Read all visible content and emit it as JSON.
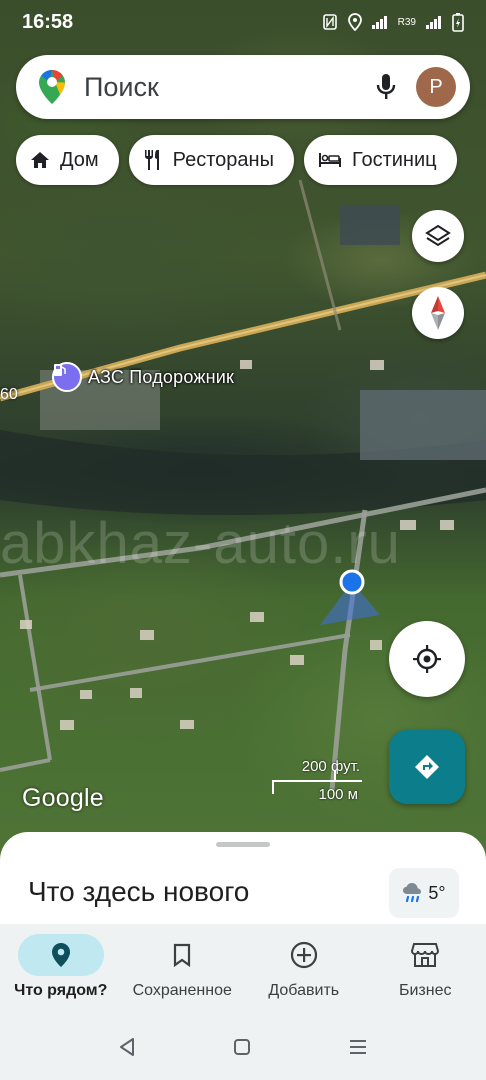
{
  "status_bar": {
    "time": "16:58",
    "network_label": "R39"
  },
  "search": {
    "placeholder": "Поиск",
    "avatar_letter": "P"
  },
  "chips": [
    {
      "label": "Дом",
      "icon": "home-icon"
    },
    {
      "label": "Рестораны",
      "icon": "restaurant-icon"
    },
    {
      "label": "Гостиниц",
      "icon": "hotel-icon"
    }
  ],
  "map": {
    "poi_label": "АЗС Подорожник",
    "road_number": "60",
    "watermark": "abkhaz-auto.ru",
    "google_logo": "Google",
    "scale_imperial": "200 фут.",
    "scale_metric": "100 м"
  },
  "sheet": {
    "title": "Что здесь нового",
    "weather_temp": "5°",
    "weather_icon": "rain-icon"
  },
  "nav": {
    "items": [
      {
        "label": "Что рядом?",
        "icon": "pin-icon",
        "active": true
      },
      {
        "label": "Сохраненное",
        "icon": "bookmark-icon",
        "active": false
      },
      {
        "label": "Добавить",
        "icon": "add-circle-icon",
        "active": false
      },
      {
        "label": "Бизнес",
        "icon": "store-icon",
        "active": false
      }
    ]
  },
  "colors": {
    "accent": "#0b7d8b",
    "active_nav_bg": "#bfe8f0",
    "avatar": "#a0684a",
    "location_dot": "#1a73e8",
    "compass_red": "#e2483d"
  }
}
